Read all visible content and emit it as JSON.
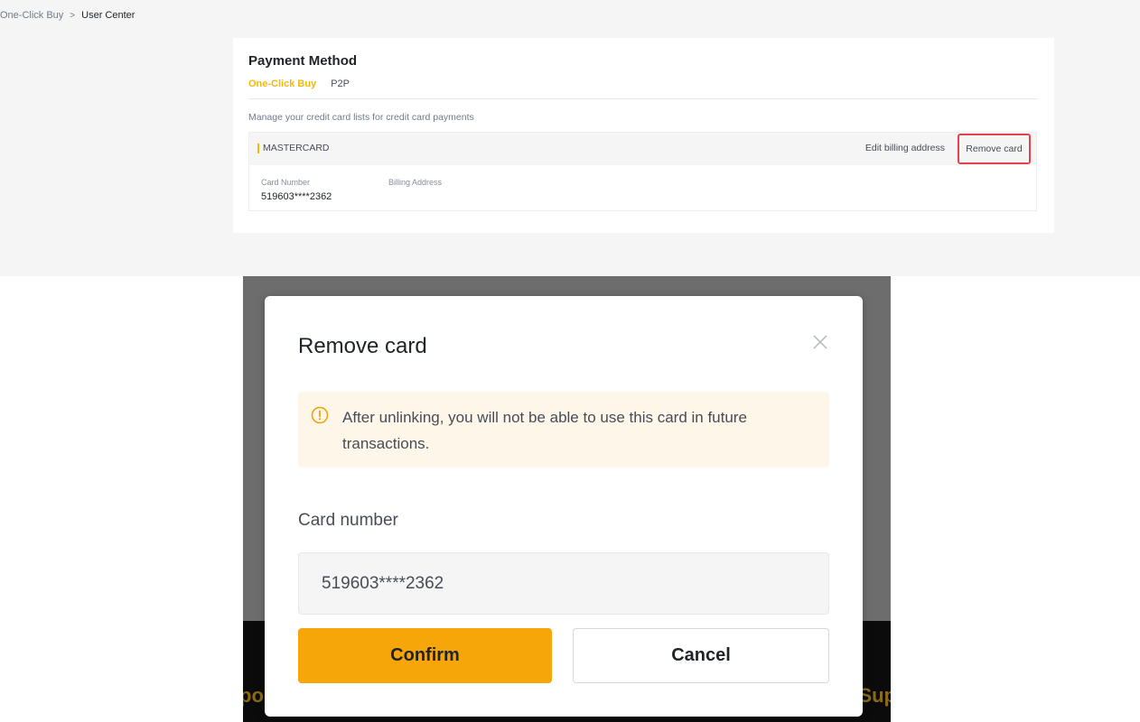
{
  "breadcrumb": {
    "items": [
      "One-Click Buy",
      "User Center"
    ],
    "separator": ">"
  },
  "payment_method": {
    "title": "Payment Method",
    "tabs": [
      {
        "label": "One-Click Buy",
        "active": true
      },
      {
        "label": "P2P",
        "active": false
      }
    ],
    "description": "Manage your credit card lists for credit card payments",
    "card": {
      "brand": "MASTERCARD",
      "edit_billing_label": "Edit billing address",
      "remove_card_label": "Remove card",
      "card_number_label": "Card Number",
      "card_number_value": "519603****2362",
      "billing_address_label": "Billing Address"
    }
  },
  "modal": {
    "title": "Remove card",
    "close_icon": "close-icon",
    "warning_icon": "warning-icon",
    "warning_text": "After unlinking, you will not be able to use this card in future transactions.",
    "field_label": "Card number",
    "card_number_value": "519603****2362",
    "confirm_label": "Confirm",
    "cancel_label": "Cancel"
  },
  "background_peek": {
    "left_fragment": "po",
    "right_fragment": "Sup"
  },
  "colors": {
    "accent": "#f0b90b",
    "confirm_button": "#f6a609",
    "highlight_border": "#e0434a",
    "warning_bg": "#fdf6e9"
  }
}
